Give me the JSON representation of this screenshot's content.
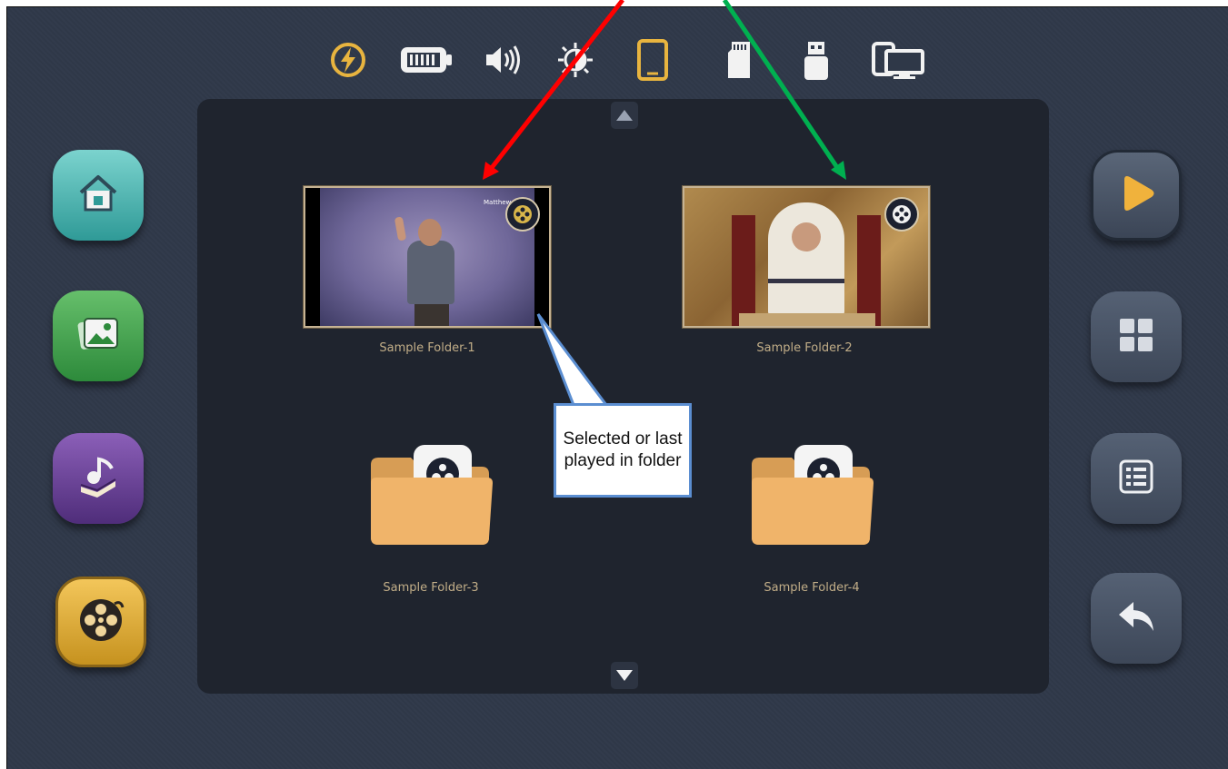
{
  "status_bar": {
    "icons": [
      "power-icon",
      "battery-icon",
      "volume-icon",
      "brightness-icon",
      "tablet-icon",
      "sd-card-icon",
      "usb-icon",
      "screen-mirror-icon"
    ]
  },
  "folders": [
    {
      "label": "Sample Folder-1",
      "kind": "thumbnail",
      "caption": "Matthew 1:17",
      "selected": true
    },
    {
      "label": "Sample Folder-2",
      "kind": "thumbnail",
      "selected": false
    },
    {
      "label": "Sample Folder-3",
      "kind": "folder",
      "selected": false
    },
    {
      "label": "Sample Folder-4",
      "kind": "folder",
      "selected": false
    }
  ],
  "left_nav": [
    "home-icon",
    "gallery-icon",
    "music-book-icon",
    "video-reel-icon"
  ],
  "right_nav": [
    "play-icon",
    "grid-view-icon",
    "list-view-icon",
    "back-icon"
  ],
  "callout": {
    "text": "Selected or last played in folder"
  },
  "colors": {
    "accent": "#e8b43f",
    "panel": "#1f242e",
    "label": "#c2ae88",
    "red_arrow": "#ff0000",
    "green_arrow": "#00b050",
    "callout_border": "#5b8ed1"
  }
}
